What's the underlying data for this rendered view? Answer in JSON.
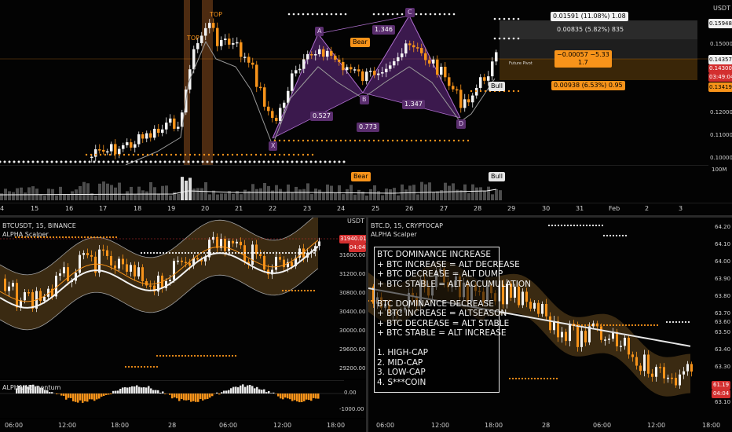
{
  "top_chart": {
    "currency": "USDT",
    "price_ticks": [
      "0.15948",
      "0.15000",
      "0.14357",
      "0.14300",
      "03:49:04",
      "0.13419",
      "0.12000",
      "0.11000",
      "0.10000"
    ],
    "time_ticks": [
      "4",
      "15",
      "16",
      "17",
      "18",
      "19",
      "20",
      "21",
      "22",
      "23",
      "24",
      "25",
      "26",
      "27",
      "28",
      "29",
      "30",
      "31",
      "Feb",
      "2",
      "3"
    ],
    "volume_tick": "100M",
    "pattern_labels": {
      "X": "X",
      "A": "A",
      "B": "B",
      "C": "C",
      "D": "D"
    },
    "ratios": {
      "xa_b": "0.527",
      "ab": "1.346",
      "bc": "1.347",
      "xd": "0.773"
    },
    "badges": {
      "bear": "Bear",
      "bull": "Bull",
      "top1": "TOP",
      "top2": "TOP",
      "vol_bear": "Bear",
      "vol_bull": "Bull"
    },
    "targets": {
      "t1": "0.01591 (11.08%) 1.08",
      "t2": "0.00835 (5.82%) 835",
      "t3": "−0.00057 −5.33\n1.7",
      "t4": "0.00938 (6.53%) 0.95",
      "pivot_label": "Future Pivot"
    },
    "price_label_colors": {
      "last": "#d32f2f",
      "orange": "#f7931a",
      "gray": "#7a7a7a"
    }
  },
  "bottom_left": {
    "symbol_line": "BTCUSDT, 15, BINANCE",
    "indicator_line": "ALPHA Scalper",
    "currency": "USDT",
    "price_ticks": [
      "31940.01",
      "04:04",
      "31600.00",
      "31200.00",
      "30800.00",
      "30400.00",
      "30000.00",
      "29600.00",
      "29200.00"
    ],
    "momentum_label": "ALPHA Momentum",
    "momentum_ticks": [
      "0.00",
      "-1000.00"
    ],
    "time_ticks": [
      "06:00",
      "12:00",
      "18:00",
      "28",
      "06:00",
      "12:00",
      "18:00"
    ]
  },
  "bottom_right": {
    "symbol_line": "BTC.D, 15, CRYPTOCAP",
    "indicator_line": "ALPHA Scalper",
    "price_ticks": [
      "64.20",
      "64.10",
      "64.00",
      "63.90",
      "63.80",
      "63.70",
      "63.60",
      "63.50",
      "63.40",
      "63.30",
      "61.19",
      "04:04",
      "63.10"
    ],
    "time_ticks": [
      "06:00",
      "12:00",
      "18:00",
      "28",
      "06:00",
      "12:00",
      "18:00"
    ],
    "note_lines": [
      "BTC DOMINANCE INCREASE",
      "+ BTC INCREASE = ALT DECREASE",
      "+ BTC DECREASE = ALT DUMP",
      "+ BTC STABLE = ALT ACCUMULATION",
      "",
      "BTC DOMINANCE DECREASE",
      "+ BTC INCREASE = ALTSEASON",
      "+ BTC DECREASE = ALT STABLE",
      "+ BTC STABLE = ALT INCREASE",
      "",
      "1. HIGH-CAP",
      "2. MID-CAP",
      "3. LOW-CAP",
      "4. S***COIN"
    ]
  }
}
